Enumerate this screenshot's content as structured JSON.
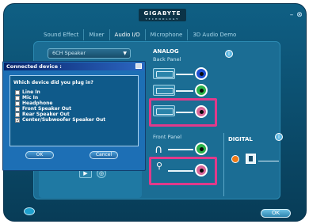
{
  "header": {
    "brand": "GIGABYTE",
    "brand_sub": "TECHNOLOGY",
    "minimize": "–",
    "close": "⊗"
  },
  "tabs": [
    {
      "label": "Sound Effect"
    },
    {
      "label": "Mixer"
    },
    {
      "label": "Audio I/O"
    },
    {
      "label": "Microphone"
    },
    {
      "label": "3D Audio Demo"
    }
  ],
  "speaker_select": {
    "value": "6CH Speaker"
  },
  "analog": {
    "title": "ANALOG",
    "back_panel": "Back Panel",
    "front_panel": "Front Panel"
  },
  "digital": {
    "title": "DIGITAL"
  },
  "info_glyph": "i",
  "dialog": {
    "title": "Connected device :",
    "question": "Which device did you plug in?",
    "options": [
      {
        "label": "Line In",
        "checked": false
      },
      {
        "label": "Mic In",
        "checked": false
      },
      {
        "label": "Headphone",
        "checked": false
      },
      {
        "label": "Front Speaker Out",
        "checked": false
      },
      {
        "label": "Rear Speaker Out",
        "checked": false
      },
      {
        "label": "Center/Subwoofer Speaker Out",
        "checked": true
      }
    ],
    "ok_label": "OK",
    "cancel_label": "Cancel"
  },
  "footer": {
    "ok_label": "OK"
  },
  "colors": {
    "highlight": "#e13a8b",
    "jack_blue": "#1f4fd1",
    "jack_green": "#2bb24a",
    "jack_pink": "#d9679a",
    "jack_orange": "#f07a17"
  }
}
